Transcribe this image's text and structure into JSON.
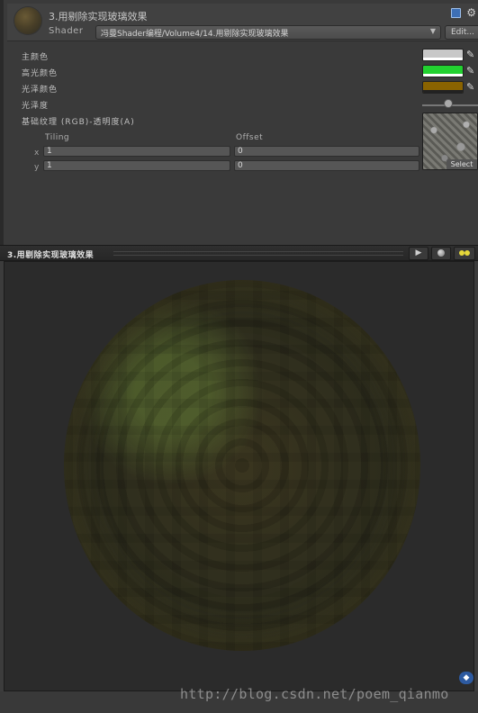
{
  "header": {
    "title": "3.用剔除实现玻璃效果",
    "shader_label": "Shader",
    "shader_value": "冯曼Shader编程/Volume4/14.用剔除实现玻璃效果",
    "edit_label": "Edit..."
  },
  "properties": {
    "main_color": {
      "label": "主颜色",
      "color": "#c8c8c8"
    },
    "specular_color": {
      "label": "高光颜色",
      "color": "#22d130"
    },
    "reflect_color": {
      "label": "光泽颜色",
      "color": "#8a6300"
    },
    "shininess": {
      "label": "光泽度"
    },
    "base_texture": {
      "label": "基础纹理 (RGB)-透明度(A)"
    }
  },
  "tiling": {
    "tiling_label": "Tiling",
    "offset_label": "Offset",
    "x_label": "x",
    "y_label": "y",
    "tiling_x": "1",
    "tiling_y": "1",
    "offset_x": "0",
    "offset_y": "0",
    "select_label": "Select"
  },
  "preview": {
    "title": "3.用剔除实现玻璃效果",
    "play_icon": "play-icon",
    "sphere_icon": "sphere-icon",
    "light_icon": "light-icon"
  },
  "footer": {
    "watermark": "http://blog.csdn.net/poem_qianmo"
  }
}
